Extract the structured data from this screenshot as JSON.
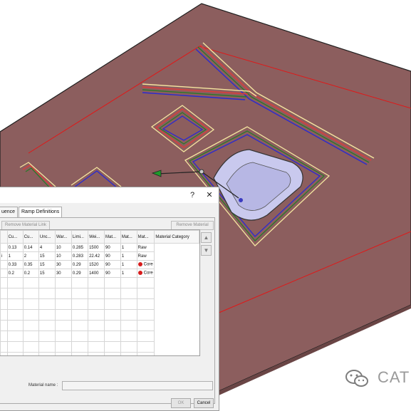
{
  "dialog": {
    "title_help": "?",
    "title_close": "✕",
    "tabs": [
      "uence",
      "Ramp Definitions"
    ],
    "toolbar": {
      "remove_link_label": "Remove Material Link",
      "remove_material_label": "Remove Material"
    },
    "table": {
      "columns": [
        "Cu...",
        "Cu...",
        "Unc...",
        "War...",
        "Limi...",
        "Wei...",
        "Mat...",
        "Mat...",
        "Mat...",
        "Material Category"
      ],
      "rows": [
        {
          "lead": "",
          "cells": [
            "0.13",
            "0.14",
            "4",
            "10",
            "0.285",
            "1500",
            "90",
            "1"
          ],
          "category": "Raw",
          "dot": false
        },
        {
          "lead": "i",
          "cells": [
            "1",
            "2",
            "15",
            "10",
            "0.283",
            "22.42",
            "90",
            "1"
          ],
          "category": "Raw",
          "dot": false
        },
        {
          "lead": "",
          "cells": [
            "0.33",
            "0.35",
            "15",
            "30",
            "0.29",
            "1520",
            "90",
            "1"
          ],
          "category": "Core",
          "dot": true
        },
        {
          "lead": "",
          "cells": [
            "0.2",
            "0.2",
            "15",
            "30",
            "0.29",
            "1400",
            "90",
            "1"
          ],
          "category": "Core",
          "dot": true
        }
      ]
    },
    "material_name_label": "Material name :",
    "material_name_value": "",
    "ok_label": "OK",
    "cancel_label": "Cancel"
  },
  "watermark": {
    "text": "CAT",
    "accent": "#7d7d7d"
  },
  "colors": {
    "surface": "#8c5e5e",
    "surface_edge": "#1e1e1e",
    "boundary_line": "#e01818",
    "pocket": "#c9c9ee"
  }
}
